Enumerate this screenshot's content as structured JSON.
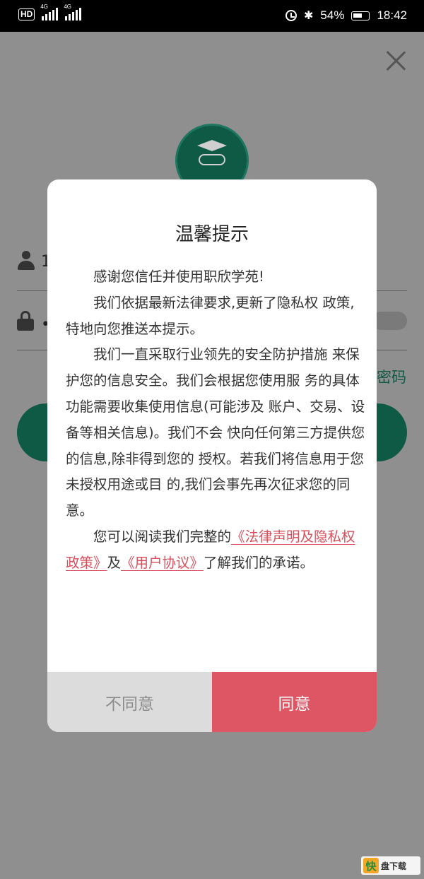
{
  "status_bar": {
    "hd": "HD",
    "net1": "4G",
    "net2": "4G",
    "battery_pct": "54%",
    "time": "18:42"
  },
  "background": {
    "username_partial": "1",
    "password_partial": "•",
    "forgot_partial": "密码"
  },
  "modal": {
    "title": "温馨提示",
    "p1": "感谢您信任并使用职欣学苑!",
    "p2": "我们依据最新法律要求,更新了隐私权 政策,特地向您推送本提示。",
    "p3": "我们一直采取行业领先的安全防护措施 来保护您的信息安全。我们会根据您使用服 务的具体功能需要收集使用信息(可能涉及 账户、交易、设备等相关信息)。我们不会 快向任何第三方提供您的信息,除非得到您的 授权。若我们将信息用于您未授权用途或目 的,我们会事先再次征求您的同意。",
    "p4_prefix": "您可以阅读我们完整的",
    "link_privacy": "《法律声明及隐私权政策》",
    "p4_and": "及",
    "link_user": "《用户协议》",
    "p4_suffix": "了解我们的承诺。",
    "disagree": "不同意",
    "agree": "同意"
  },
  "watermark": {
    "mark": "快",
    "text": "盘下载"
  }
}
